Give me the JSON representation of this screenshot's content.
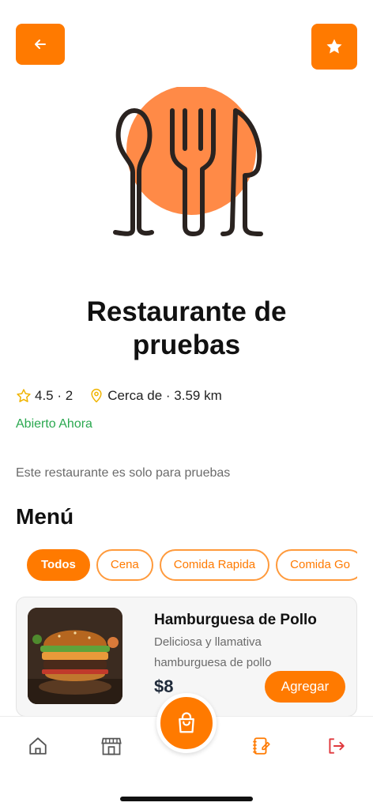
{
  "colors": {
    "accent": "#ff7a00",
    "open": "#2aa84f",
    "logout": "#e0393e"
  },
  "header": {
    "back_icon": "arrow-left-icon",
    "fav_icon": "star-icon"
  },
  "restaurant": {
    "name_line1": "Restaurante de",
    "name_line2": "pruebas",
    "rating": "4.5 · 2",
    "distance": "Cerca de · 3.59 km",
    "status": "Abierto Ahora",
    "description": "Este restaurante es solo para pruebas"
  },
  "menu": {
    "heading": "Menú",
    "categories": [
      {
        "label": "Todos",
        "active": true
      },
      {
        "label": "Cena",
        "active": false
      },
      {
        "label": "Comida Rapida",
        "active": false
      },
      {
        "label": "Comida Go",
        "active": false
      }
    ],
    "items": [
      {
        "name": "Hamburguesa de Pollo",
        "description_line1": "Deliciosa y llamativa",
        "description_line2": "hamburguesa de pollo",
        "price": "$8",
        "add_label": "Agregar"
      }
    ]
  },
  "navbar": {
    "icons": [
      "home-icon",
      "store-icon",
      "cart-icon",
      "notebook-icon",
      "logout-icon"
    ]
  }
}
